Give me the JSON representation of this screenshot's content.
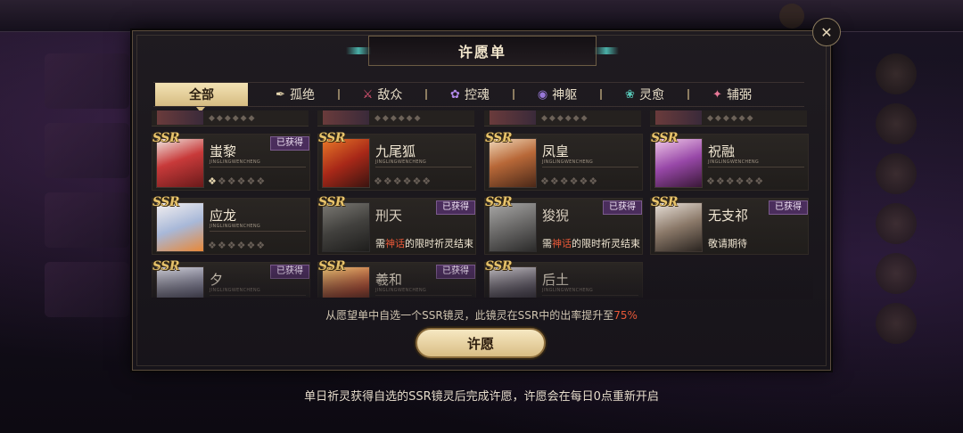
{
  "dialog": {
    "title": "许愿单",
    "close_label": "✕",
    "info_text": "从愿望单中自选一个SSR镜灵，此镜灵在SSR中的出率提升至",
    "info_pct": "75%",
    "wish_button": "许愿",
    "footer_text": "单日祈灵获得自选的SSR镜灵后完成许愿，许愿会在每日0点重新开启"
  },
  "tabs": [
    {
      "label": "全部",
      "icon": "",
      "icon_name": "none"
    },
    {
      "label": "孤绝",
      "icon": "✒",
      "icon_name": "dagger-icon"
    },
    {
      "label": "敌众",
      "icon": "⚔",
      "icon_name": "slash-icon"
    },
    {
      "label": "控魂",
      "icon": "✿",
      "icon_name": "spirit-icon"
    },
    {
      "label": "神躯",
      "icon": "◉",
      "icon_name": "body-icon"
    },
    {
      "label": "灵愈",
      "icon": "❀",
      "icon_name": "lotus-icon"
    },
    {
      "label": "辅弼",
      "icon": "✦",
      "icon_name": "star-icon"
    }
  ],
  "cards": [
    {
      "rarity": "SSR",
      "name": "蚩黎",
      "pinyin": "JINGLINGWENCHENG",
      "badge": "已获得",
      "moths_lit": 1,
      "moths_total": 6,
      "locked": false
    },
    {
      "rarity": "SSR",
      "name": "九尾狐",
      "pinyin": "JINGLINGWENCHENG",
      "badge": "",
      "moths_lit": 0,
      "moths_total": 6,
      "locked": false
    },
    {
      "rarity": "SSR",
      "name": "凤皇",
      "pinyin": "JINGLINGWENCHENG",
      "badge": "",
      "moths_lit": 0,
      "moths_total": 6,
      "locked": false
    },
    {
      "rarity": "SSR",
      "name": "祝融",
      "pinyin": "JINGLINGWENCHENG",
      "badge": "",
      "moths_lit": 0,
      "moths_total": 6,
      "locked": false
    },
    {
      "rarity": "SSR",
      "name": "应龙",
      "pinyin": "JINGLINGWENCHENG",
      "badge": "",
      "moths_lit": 0,
      "moths_total": 6,
      "locked": false
    },
    {
      "rarity": "SSR",
      "name": "刑天",
      "pinyin": "",
      "badge": "已获得",
      "req_pre": "需",
      "req_hl": "神话",
      "req_post": "的限时祈灵结束",
      "locked": true
    },
    {
      "rarity": "SSR",
      "name": "狻猊",
      "pinyin": "",
      "badge": "已获得",
      "req_pre": "需",
      "req_hl": "神话",
      "req_post": "的限时祈灵结束",
      "locked": true
    },
    {
      "rarity": "SSR",
      "name": "无支祁",
      "pinyin": "",
      "badge": "已获得",
      "req_pre": "",
      "req_hl": "",
      "req_post": "敬请期待",
      "locked": false
    },
    {
      "rarity": "SSR",
      "name": "夕",
      "pinyin": "JINGLINGWENCHENG",
      "badge": "已获得",
      "locked": false
    },
    {
      "rarity": "SSR",
      "name": "羲和",
      "pinyin": "JINGLINGWENCHENG",
      "badge": "已获得",
      "locked": false
    },
    {
      "rarity": "SSR",
      "name": "后土",
      "pinyin": "JINGLINGWENCHENG",
      "badge": "",
      "locked": false
    }
  ],
  "colors": {
    "accent_gold": "#d9bd84",
    "highlight_red": "#e85838",
    "badge_purple": "#4a2d5c"
  }
}
